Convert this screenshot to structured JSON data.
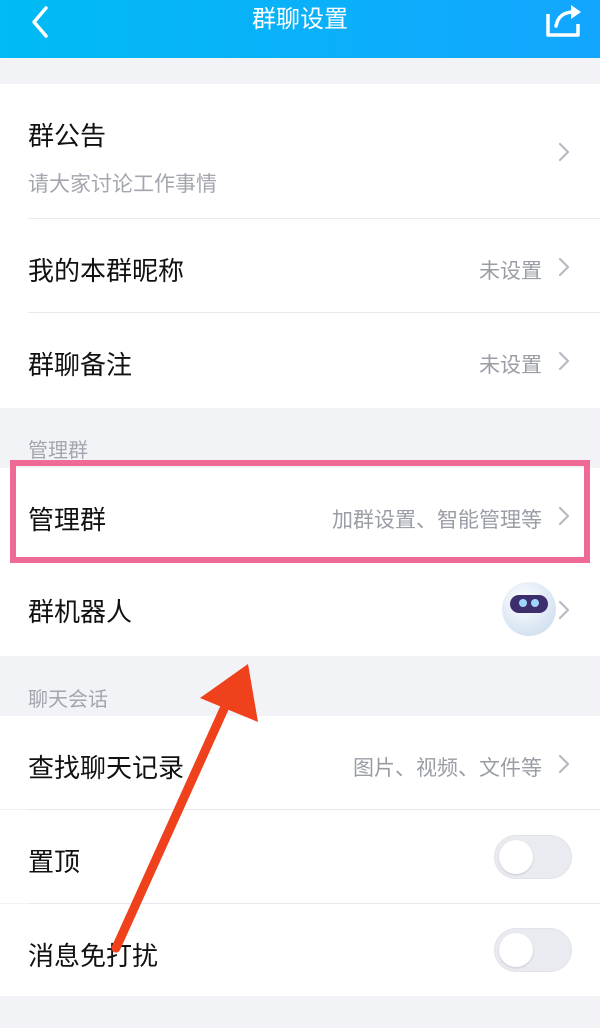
{
  "header": {
    "title": "群聊设置",
    "back_icon": "chevron-left-icon",
    "share_icon": "share-icon",
    "background": "#10aaf8"
  },
  "rows": {
    "announcement": {
      "label": "群公告",
      "subtitle": "请大家讨论工作事情"
    },
    "nickname": {
      "label": "我的本群昵称",
      "value": "未设置"
    },
    "remark": {
      "label": "群聊备注",
      "value": "未设置"
    },
    "manage": {
      "label": "管理群",
      "value": "加群设置、智能管理等"
    },
    "robot": {
      "label": "群机器人"
    },
    "search": {
      "label": "查找聊天记录",
      "value": "图片、视频、文件等"
    },
    "pin": {
      "label": "置顶",
      "toggle": false
    },
    "dnd": {
      "label": "消息免打扰",
      "toggle": false
    }
  },
  "groups": {
    "manage_group": "管理群",
    "chat_group": "聊天会话"
  },
  "annotation": {
    "highlight_color": "#ef6b95",
    "arrow_color": "#f0411d"
  }
}
